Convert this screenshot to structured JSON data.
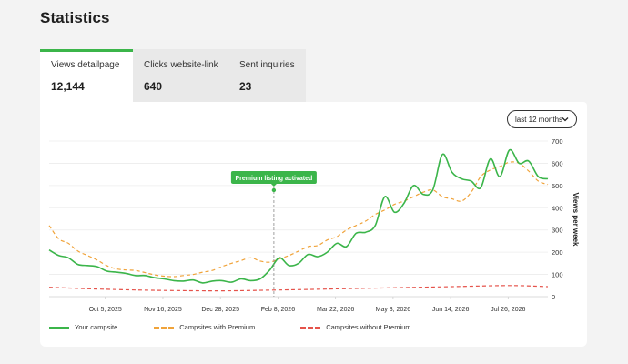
{
  "page": {
    "title": "Statistics"
  },
  "tabs": [
    {
      "label": "Views detailpage",
      "value": "12,144",
      "active": true
    },
    {
      "label": "Clicks website-link",
      "value": "640",
      "active": false
    },
    {
      "label": "Sent inquiries",
      "value": "23",
      "active": false
    }
  ],
  "range_select": {
    "value": "last 12 months"
  },
  "annotation": {
    "label": "Premium listing activated"
  },
  "colors": {
    "accent": "#3bb54a",
    "premium": "#f0a33a",
    "without_premium": "#e5534b"
  },
  "chart_data": {
    "type": "line",
    "title": "",
    "ylabel": "Views per week",
    "ylim": [
      0,
      700
    ],
    "yticks": [
      0,
      100,
      200,
      300,
      400,
      500,
      600,
      700
    ],
    "x_range": [
      "2025-08-25",
      "2026-08-24"
    ],
    "x_ticks": [
      {
        "date": "2025-10-05",
        "label": "Oct 5, 2025"
      },
      {
        "date": "2025-11-16",
        "label": "Nov 16, 2025"
      },
      {
        "date": "2025-12-28",
        "label": "Dec 28, 2025"
      },
      {
        "date": "2026-02-08",
        "label": "Feb 8, 2026"
      },
      {
        "date": "2026-03-22",
        "label": "Mar 22, 2026"
      },
      {
        "date": "2026-05-03",
        "label": "May 3, 2026"
      },
      {
        "date": "2026-06-14",
        "label": "Jun 14, 2026"
      },
      {
        "date": "2026-07-26",
        "label": "Jul 26, 2026"
      }
    ],
    "annotation_date": "2026-02-05",
    "grid": true,
    "legend_position": "bottom",
    "series": [
      {
        "name": "Your campsite",
        "style": "solid",
        "points": [
          [
            "2025-08-25",
            210
          ],
          [
            "2025-09-01",
            185
          ],
          [
            "2025-09-08",
            175
          ],
          [
            "2025-09-15",
            145
          ],
          [
            "2025-09-22",
            140
          ],
          [
            "2025-09-29",
            135
          ],
          [
            "2025-10-06",
            115
          ],
          [
            "2025-10-13",
            110
          ],
          [
            "2025-10-20",
            105
          ],
          [
            "2025-10-27",
            95
          ],
          [
            "2025-11-03",
            95
          ],
          [
            "2025-11-10",
            85
          ],
          [
            "2025-11-17",
            80
          ],
          [
            "2025-11-24",
            72
          ],
          [
            "2025-12-01",
            70
          ],
          [
            "2025-12-08",
            75
          ],
          [
            "2025-12-15",
            62
          ],
          [
            "2025-12-22",
            70
          ],
          [
            "2025-12-29",
            72
          ],
          [
            "2026-01-05",
            65
          ],
          [
            "2026-01-12",
            80
          ],
          [
            "2026-01-19",
            72
          ],
          [
            "2026-01-26",
            80
          ],
          [
            "2026-02-02",
            120
          ],
          [
            "2026-02-09",
            175
          ],
          [
            "2026-02-16",
            140
          ],
          [
            "2026-02-23",
            150
          ],
          [
            "2026-03-02",
            190
          ],
          [
            "2026-03-09",
            180
          ],
          [
            "2026-03-16",
            200
          ],
          [
            "2026-03-23",
            240
          ],
          [
            "2026-03-30",
            225
          ],
          [
            "2026-04-06",
            285
          ],
          [
            "2026-04-13",
            290
          ],
          [
            "2026-04-20",
            320
          ],
          [
            "2026-04-27",
            450
          ],
          [
            "2026-05-04",
            380
          ],
          [
            "2026-05-11",
            420
          ],
          [
            "2026-05-18",
            500
          ],
          [
            "2026-05-25",
            460
          ],
          [
            "2026-06-01",
            480
          ],
          [
            "2026-06-08",
            640
          ],
          [
            "2026-06-15",
            560
          ],
          [
            "2026-06-22",
            530
          ],
          [
            "2026-06-29",
            520
          ],
          [
            "2026-07-06",
            490
          ],
          [
            "2026-07-13",
            620
          ],
          [
            "2026-07-20",
            540
          ],
          [
            "2026-07-27",
            660
          ],
          [
            "2026-08-03",
            600
          ],
          [
            "2026-08-10",
            610
          ],
          [
            "2026-08-17",
            540
          ],
          [
            "2026-08-24",
            530
          ]
        ]
      },
      {
        "name": "Campsites with Premium",
        "style": "dashed",
        "points": [
          [
            "2025-08-25",
            320
          ],
          [
            "2025-09-01",
            260
          ],
          [
            "2025-09-08",
            240
          ],
          [
            "2025-09-15",
            205
          ],
          [
            "2025-09-22",
            185
          ],
          [
            "2025-09-29",
            165
          ],
          [
            "2025-10-06",
            140
          ],
          [
            "2025-10-13",
            125
          ],
          [
            "2025-10-20",
            120
          ],
          [
            "2025-10-27",
            118
          ],
          [
            "2025-11-03",
            108
          ],
          [
            "2025-11-10",
            98
          ],
          [
            "2025-11-17",
            92
          ],
          [
            "2025-11-24",
            90
          ],
          [
            "2025-12-01",
            95
          ],
          [
            "2025-12-08",
            100
          ],
          [
            "2025-12-15",
            110
          ],
          [
            "2025-12-22",
            118
          ],
          [
            "2025-12-29",
            135
          ],
          [
            "2026-01-05",
            150
          ],
          [
            "2026-01-12",
            162
          ],
          [
            "2026-01-19",
            175
          ],
          [
            "2026-01-26",
            160
          ],
          [
            "2026-02-02",
            155
          ],
          [
            "2026-02-09",
            170
          ],
          [
            "2026-02-16",
            185
          ],
          [
            "2026-02-23",
            205
          ],
          [
            "2026-03-02",
            225
          ],
          [
            "2026-03-09",
            230
          ],
          [
            "2026-03-16",
            255
          ],
          [
            "2026-03-23",
            270
          ],
          [
            "2026-03-30",
            300
          ],
          [
            "2026-04-06",
            320
          ],
          [
            "2026-04-13",
            340
          ],
          [
            "2026-04-20",
            370
          ],
          [
            "2026-04-27",
            390
          ],
          [
            "2026-05-04",
            415
          ],
          [
            "2026-05-11",
            430
          ],
          [
            "2026-05-18",
            450
          ],
          [
            "2026-05-25",
            470
          ],
          [
            "2026-06-01",
            480
          ],
          [
            "2026-06-08",
            450
          ],
          [
            "2026-06-15",
            440
          ],
          [
            "2026-06-22",
            430
          ],
          [
            "2026-06-29",
            470
          ],
          [
            "2026-07-06",
            540
          ],
          [
            "2026-07-13",
            570
          ],
          [
            "2026-07-20",
            585
          ],
          [
            "2026-07-27",
            605
          ],
          [
            "2026-08-03",
            600
          ],
          [
            "2026-08-10",
            565
          ],
          [
            "2026-08-17",
            520
          ],
          [
            "2026-08-24",
            505
          ]
        ]
      },
      {
        "name": "Campsites without Premium",
        "style": "dashed",
        "points": [
          [
            "2025-08-25",
            42
          ],
          [
            "2025-10-06",
            33
          ],
          [
            "2025-11-17",
            28
          ],
          [
            "2025-12-29",
            26
          ],
          [
            "2026-02-09",
            30
          ],
          [
            "2026-03-23",
            35
          ],
          [
            "2026-05-04",
            40
          ],
          [
            "2026-06-15",
            45
          ],
          [
            "2026-07-27",
            50
          ],
          [
            "2026-08-24",
            45
          ]
        ]
      }
    ]
  }
}
